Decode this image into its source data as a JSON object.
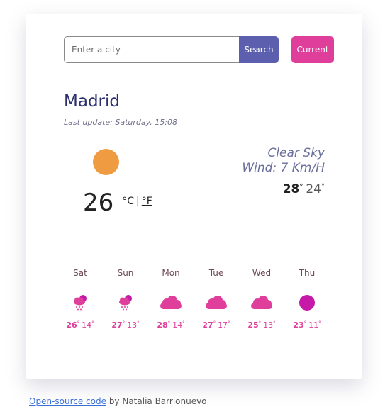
{
  "search": {
    "placeholder": "Enter a city",
    "value": "",
    "search_label": "Search",
    "current_label": "Current"
  },
  "weather": {
    "city": "Madrid",
    "last_update": "Last update: Saturday, 15:08",
    "description": "Clear Sky",
    "wind": "Wind: 7 Km/H",
    "temperature": "26",
    "unit_c": "°C",
    "unit_separator": "|",
    "unit_f": "°F",
    "today_max": "28",
    "today_min": "24",
    "icon": "sun-icon"
  },
  "forecast": [
    {
      "day": "Sat",
      "icon": "sun-rain-cloud-icon",
      "max": "26",
      "min": "14"
    },
    {
      "day": "Sun",
      "icon": "sun-rain-cloud-icon",
      "max": "27",
      "min": "13"
    },
    {
      "day": "Mon",
      "icon": "cloud-icon",
      "max": "28",
      "min": "14"
    },
    {
      "day": "Tue",
      "icon": "cloud-icon",
      "max": "27",
      "min": "17"
    },
    {
      "day": "Wed",
      "icon": "cloud-icon",
      "max": "25",
      "min": "13"
    },
    {
      "day": "Thu",
      "icon": "sun-icon",
      "max": "23",
      "min": "11"
    }
  ],
  "footer": {
    "link_text": "Open-source code",
    "author_text": "by Natalia Barrionuevo"
  },
  "colors": {
    "search_button": "#5b5fae",
    "current_button": "#df3f9b",
    "sun_main": "#ef9b42",
    "forecast_accent": "#df3f9b",
    "forecast_sun": "#c51aa8"
  }
}
